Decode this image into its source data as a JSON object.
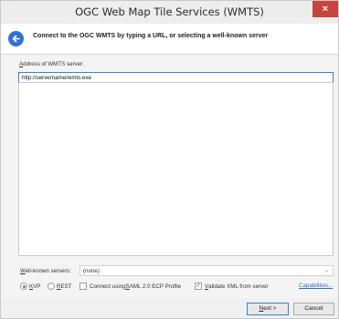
{
  "window": {
    "title": "OGC Web Map Tile Services (WMTS)",
    "close_glyph": "×"
  },
  "header": {
    "back_icon": "arrow-left-icon",
    "text": "Connect to the OGC WMTS by typing a URL, or selecting a well-known server"
  },
  "address": {
    "label_hotkey": "A",
    "label_rest": "ddress of WMTS server:",
    "value": "http://servername/wmts.exe"
  },
  "well_known": {
    "label_hotkey": "W",
    "label_rest": "ell-known servers:",
    "selected": "(none)"
  },
  "options": {
    "kvp": {
      "hotkey": "K",
      "rest": "VP",
      "selected": true
    },
    "rest": {
      "hotkey": "R",
      "rest": "EST",
      "selected": false
    },
    "saml": {
      "prefix": "Connect using ",
      "hotkey": "S",
      "rest": "AML 2.0 ECP Profile",
      "checked": false
    },
    "validate": {
      "hotkey": "V",
      "rest": "alidate XML from server",
      "checked": true
    },
    "capabilities_link": "Capabilities..."
  },
  "footer": {
    "next_hotkey": "N",
    "next_rest": "ext >",
    "cancel": "Cancel"
  },
  "colors": {
    "accent": "#2f73d1",
    "close": "#c7453f",
    "link": "#2f6fc9"
  }
}
